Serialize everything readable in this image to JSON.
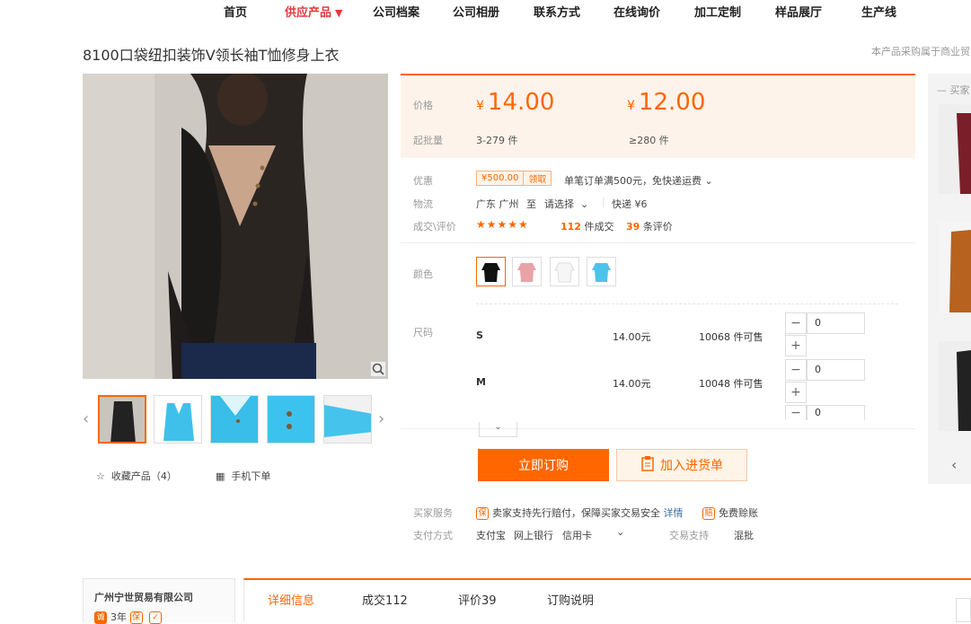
{
  "nav": {
    "items": [
      "首页",
      "供应产品",
      "公司档案",
      "公司相册",
      "联系方式",
      "在线询价",
      "加工定制",
      "样品展厅",
      "生产线"
    ],
    "active_caret": "▼"
  },
  "product": {
    "title": "8100口袋纽扣装饰V领长袖T恤修身上衣",
    "top_note": "本产品采购属于商业贸"
  },
  "gallery": {
    "favorite_label": "收藏产品（4）",
    "mobile_label": "手机下单",
    "prev_arrow": "‹",
    "next_arrow": "›"
  },
  "price": {
    "label": "价格",
    "moq_label": "起批量",
    "currency": "¥",
    "tiers": [
      {
        "price": "14.00",
        "range": "3-279 件"
      },
      {
        "price": "12.00",
        "range": "≥280 件"
      }
    ]
  },
  "info": {
    "promo_label": "优惠",
    "coupon_amount": "¥500.00",
    "coupon_action": "领取",
    "promo_text": "单笔订单满500元，免快递运费",
    "logistics_label": "物流",
    "origin": "广东 广州",
    "to": "至",
    "destination": "请选择",
    "shipping": "快递 ¥6",
    "deals_label": "成交\\评价",
    "stars": "★★★★★",
    "deal_count": "112",
    "deal_suffix": "件成交",
    "review_count": "39",
    "review_suffix": "条评价"
  },
  "color": {
    "label": "颜色",
    "swatches": [
      "#111111",
      "#e8a3a6",
      "#f4f4f4",
      "#4cc3ea"
    ]
  },
  "sizes": {
    "label": "尺码",
    "rows": [
      {
        "name": "S",
        "price": "14.00元",
        "stock": "10068 件可售",
        "qty": "0"
      },
      {
        "name": "M",
        "price": "14.00元",
        "stock": "10048 件可售",
        "qty": "0"
      }
    ],
    "third_qty": "0",
    "minus": "−",
    "plus": "+",
    "expand": "⌄"
  },
  "actions": {
    "order": "立即订购",
    "cart": "加入进货单"
  },
  "service": {
    "buyer_label": "买家服务",
    "guarantee_badge": "保",
    "guarantee_text": "卖家支持先行赔付，保障买家交易安全",
    "detail_link": "详情",
    "exempt_badge": "赔",
    "exempt_text": "免费赊账",
    "pay_label": "支付方式",
    "pay_methods": [
      "支付宝",
      "网上银行",
      "信用卡"
    ],
    "trade_label": "交易支持",
    "trade_value": "混批"
  },
  "rail": {
    "title": "买家",
    "prev": "‹"
  },
  "company": {
    "name": "广州宁世贸易有限公司",
    "years": "3年"
  },
  "tabs": [
    {
      "label": "详细信息",
      "active": true
    },
    {
      "label": "成交112",
      "active": false
    },
    {
      "label": "评价39",
      "active": false
    },
    {
      "label": "订购说明",
      "active": false
    }
  ]
}
